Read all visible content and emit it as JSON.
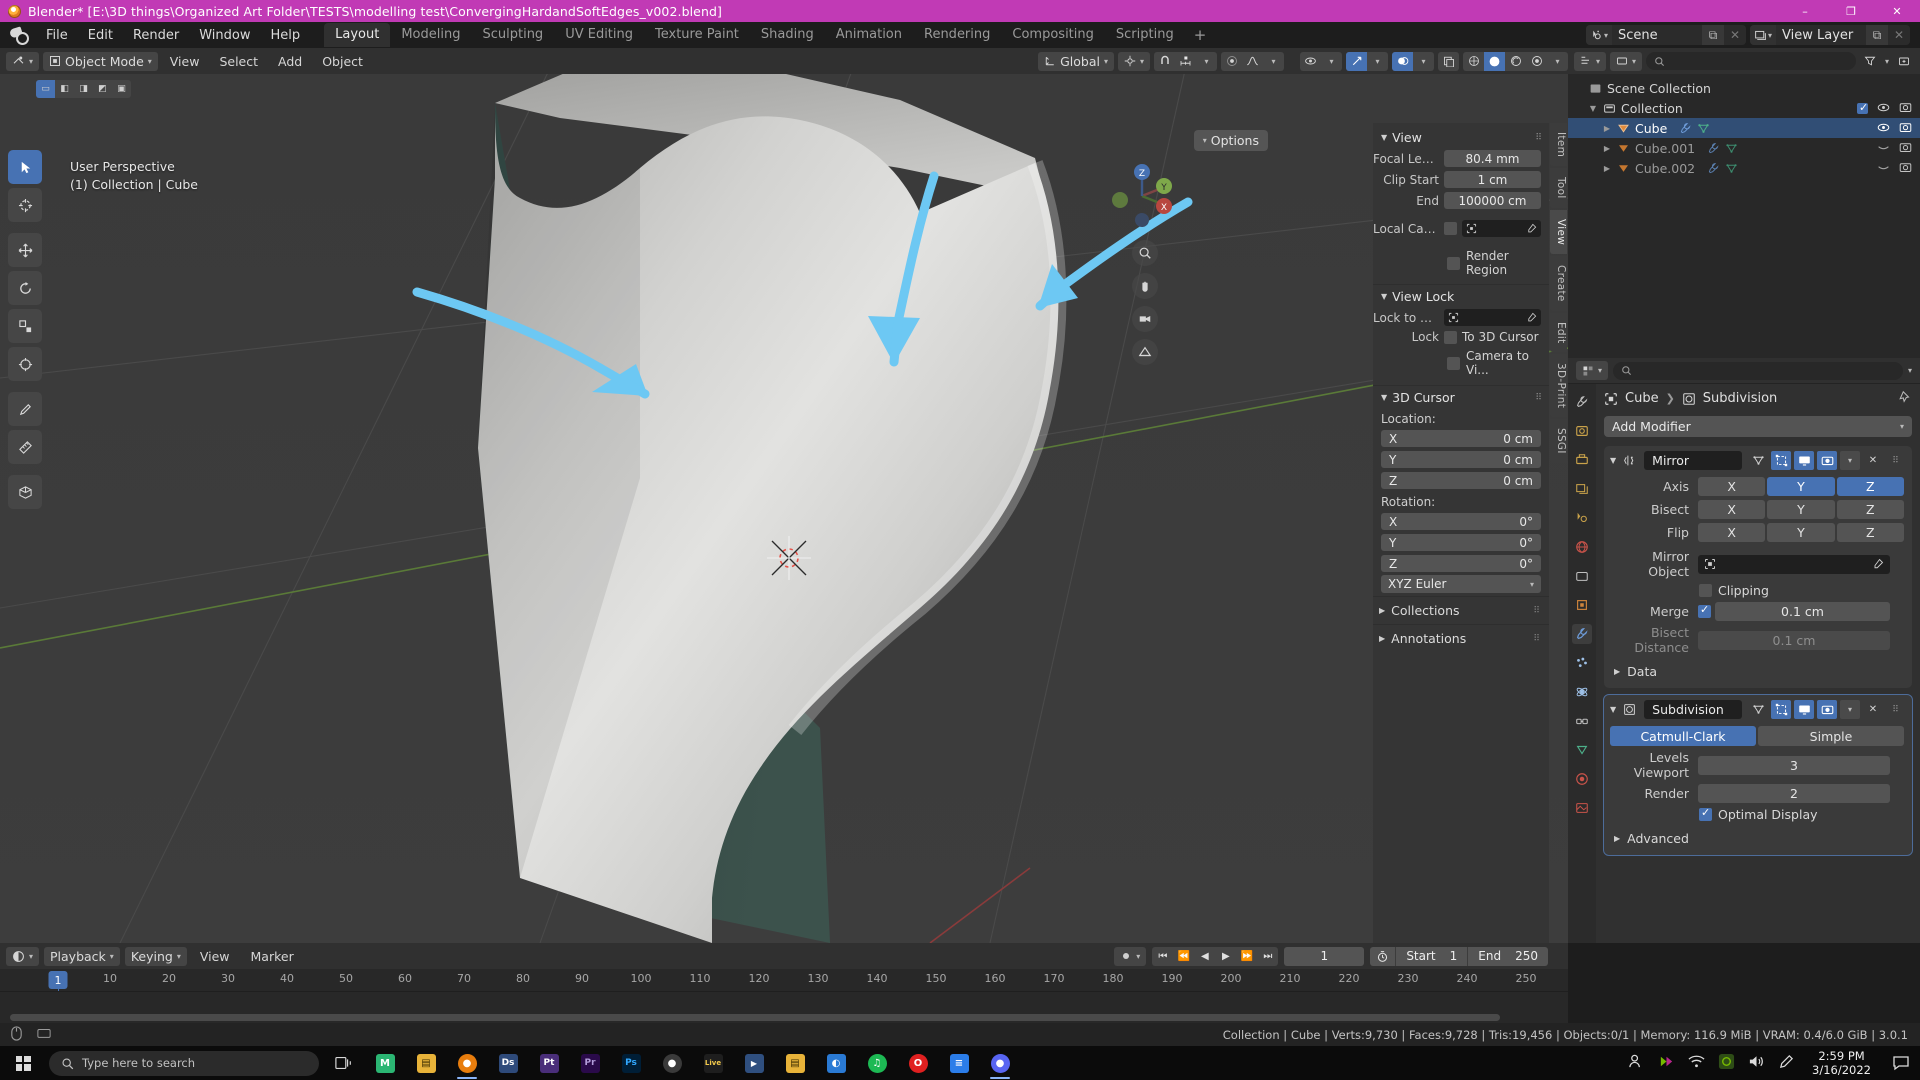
{
  "window": {
    "title": "Blender* [E:\\3D things\\Organized Art Folder\\TESTS\\modelling test\\ConvergingHardandSoftEdges_v002.blend]",
    "minimize": "–",
    "maximize": "❐",
    "close": "✕"
  },
  "topbar": {
    "menus": [
      "File",
      "Edit",
      "Render",
      "Window",
      "Help"
    ],
    "workspaces": [
      "Layout",
      "Modeling",
      "Sculpting",
      "UV Editing",
      "Texture Paint",
      "Shading",
      "Animation",
      "Rendering",
      "Compositing",
      "Scripting"
    ],
    "active_workspace": "Layout",
    "add_workspace": "+",
    "scene_name": "Scene",
    "view_layer_name": "View Layer",
    "copy_glyph": "⧉",
    "x_glyph": "✕"
  },
  "viewport": {
    "mode": "Object Mode",
    "menus": [
      "View",
      "Select",
      "Add",
      "Object"
    ],
    "transform_orientation": "Global",
    "options_label": "Options",
    "overlay_line1": "User Perspective",
    "overlay_line2": "(1) Collection | Cube",
    "gizmo_axes": [
      "X",
      "Y",
      "Z"
    ]
  },
  "npanel": {
    "tabs": [
      "Item",
      "Tool",
      "View",
      "Create",
      "Edit",
      "3D-Print",
      "SSGI"
    ],
    "active_tab": "View",
    "view_section": {
      "title": "View",
      "rows": [
        {
          "label": "Focal Lengt",
          "value": "80.4 mm"
        },
        {
          "label": "Clip Start",
          "value": "1 cm"
        },
        {
          "label": "End",
          "value": "100000 cm"
        }
      ],
      "local_camera_label": "Local Cam...",
      "render_region_label": "Render Region"
    },
    "view_lock_section": {
      "title": "View Lock",
      "lock_to_object_label": "Lock to Ob...",
      "lock_label": "Lock",
      "to_3d_cursor_label": "To 3D Cursor",
      "camera_to_view_label": "Camera to Vi..."
    },
    "cursor_section": {
      "title": "3D Cursor",
      "location_label": "Location:",
      "location": [
        {
          "axis": "X",
          "value": "0 cm"
        },
        {
          "axis": "Y",
          "value": "0 cm"
        },
        {
          "axis": "Z",
          "value": "0 cm"
        }
      ],
      "rotation_label": "Rotation:",
      "rotation": [
        {
          "axis": "X",
          "value": "0°"
        },
        {
          "axis": "Y",
          "value": "0°"
        },
        {
          "axis": "Z",
          "value": "0°"
        }
      ],
      "rotation_mode": "XYZ Euler"
    },
    "closed_sections": [
      "Collections",
      "Annotations"
    ]
  },
  "outliner": {
    "search_placeholder": "",
    "rows": [
      {
        "name": "Scene Collection",
        "indent": 0,
        "selected": false,
        "arrow": false,
        "icon": "scene-collection-icon",
        "dim": false,
        "eye": false,
        "camera": false,
        "checkbox": false
      },
      {
        "name": "Collection",
        "indent": 1,
        "selected": false,
        "arrow": true,
        "icon": "collection-icon",
        "dim": false,
        "eye": true,
        "camera": true,
        "checkbox": true
      },
      {
        "name": "Cube",
        "indent": 2,
        "selected": true,
        "arrow": true,
        "icon": "mesh-icon",
        "dim": false,
        "eye": true,
        "camera": true,
        "checkbox": false
      },
      {
        "name": "Cube.001",
        "indent": 2,
        "selected": false,
        "arrow": true,
        "icon": "mesh-icon",
        "dim": true,
        "eye": false,
        "camera": true,
        "checkbox": false
      },
      {
        "name": "Cube.002",
        "indent": 2,
        "selected": false,
        "arrow": true,
        "icon": "mesh-icon",
        "dim": true,
        "eye": false,
        "camera": true,
        "checkbox": false
      }
    ]
  },
  "properties": {
    "breadcrumb_object": "Cube",
    "breadcrumb_modifier": "Subdivision",
    "add_modifier_label": "Add Modifier",
    "modifiers": [
      {
        "name": "Mirror",
        "active": false,
        "rows": [
          {
            "label": "Axis",
            "type": "xyz",
            "values": [
              "X",
              "Y",
              "Z"
            ],
            "on": [
              false,
              true,
              true
            ]
          },
          {
            "label": "Bisect",
            "type": "xyz",
            "values": [
              "X",
              "Y",
              "Z"
            ],
            "on": [
              false,
              false,
              false
            ]
          },
          {
            "label": "Flip",
            "type": "xyz",
            "values": [
              "X",
              "Y",
              "Z"
            ],
            "on": [
              false,
              false,
              false
            ]
          }
        ],
        "mirror_object_label": "Mirror Object",
        "clipping_label": "Clipping",
        "clipping_on": false,
        "merge_label": "Merge",
        "merge_on": true,
        "merge_value": "0.1 cm",
        "bisect_distance_label": "Bisect Distance",
        "bisect_distance_value": "0.1 cm",
        "data_label": "Data"
      },
      {
        "name": "Subdivision",
        "active": true,
        "type_options": [
          "Catmull-Clark",
          "Simple"
        ],
        "type_selected": "Catmull-Clark",
        "levels_viewport_label": "Levels Viewport",
        "levels_viewport_value": "3",
        "render_label": "Render",
        "render_value": "2",
        "optimal_display_label": "Optimal Display",
        "optimal_display_on": true,
        "advanced_label": "Advanced"
      }
    ]
  },
  "timeline": {
    "menus": [
      "Playback",
      "Keying",
      "View",
      "Marker"
    ],
    "current_frame": "1",
    "start_label": "Start",
    "start_value": "1",
    "end_label": "End",
    "end_value": "250",
    "ticks": [
      "10",
      "20",
      "30",
      "40",
      "50",
      "60",
      "70",
      "80",
      "90",
      "100",
      "110",
      "120",
      "130",
      "140",
      "150",
      "160",
      "170",
      "180",
      "190",
      "200",
      "210",
      "220",
      "230",
      "240",
      "250"
    ],
    "playhead_frame": "1"
  },
  "statusbar": {
    "text": "Collection | Cube | Verts:9,730 | Faces:9,728 | Tris:19,456 | Objects:0/1 | Memory: 116.9 MiB | VRAM: 0.4/6.0 GiB | 3.0.1"
  },
  "taskbar": {
    "search_placeholder": "Type here to search",
    "clock_time": "2:59 PM",
    "clock_date": "3/16/2022",
    "apps": [
      {
        "name": "task-view",
        "label": "▣",
        "color": "transparent",
        "running": false
      },
      {
        "name": "app-mega",
        "label": "M",
        "color": "#2bb673",
        "running": false
      },
      {
        "name": "app-folder",
        "label": "▤",
        "color": "#e8b339",
        "running": false
      },
      {
        "name": "app-blender",
        "label": "●",
        "color": "#e87d0d",
        "running": true
      },
      {
        "name": "app-designer",
        "label": "Ds",
        "color": "#2e4a7a",
        "running": false
      },
      {
        "name": "app-photo",
        "label": "Pt",
        "color": "#4a2e7a",
        "running": false
      },
      {
        "name": "app-premiere",
        "label": "Pr",
        "color": "#2a0a4a",
        "running": false
      },
      {
        "name": "app-photoshop",
        "label": "Ps",
        "color": "#001e36",
        "running": false
      },
      {
        "name": "app-substance",
        "label": "●",
        "color": "#3a3a3a",
        "running": false
      },
      {
        "name": "app-live",
        "label": "Live",
        "color": "#1e1e1e",
        "running": false
      },
      {
        "name": "app-video",
        "label": "▶",
        "color": "#2f4f7f",
        "running": false
      },
      {
        "name": "app-explorer",
        "label": "▤",
        "color": "#e8b339",
        "running": false
      },
      {
        "name": "app-paint",
        "label": "◐",
        "color": "#2a7ad4",
        "running": false
      },
      {
        "name": "app-spotify",
        "label": "♫",
        "color": "#1db954",
        "running": false
      },
      {
        "name": "app-opera",
        "label": "O",
        "color": "#e02020",
        "running": false
      },
      {
        "name": "app-docs",
        "label": "≡",
        "color": "#2b7de9",
        "running": false
      },
      {
        "name": "app-discord",
        "label": "●",
        "color": "#5865f2",
        "running": true
      }
    ]
  }
}
